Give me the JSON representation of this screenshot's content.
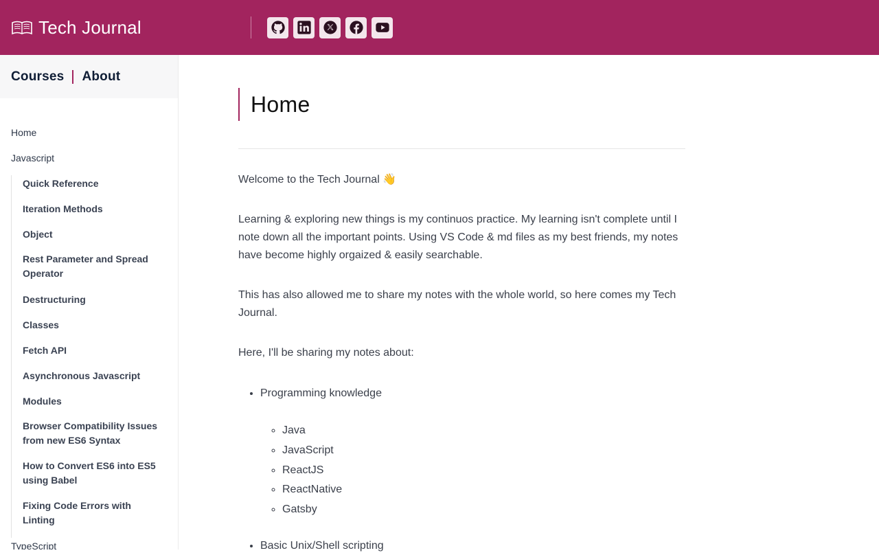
{
  "header": {
    "title": "Tech Journal",
    "brand_icon": "open-book-icon",
    "background": "#a2245e",
    "socials": [
      {
        "name": "github-icon"
      },
      {
        "name": "linkedin-icon"
      },
      {
        "name": "x-twitter-icon"
      },
      {
        "name": "facebook-icon"
      },
      {
        "name": "youtube-icon"
      }
    ]
  },
  "sidebar": {
    "top_links": [
      "Courses",
      "About"
    ],
    "items": {
      "home": "Home",
      "javascript": "Javascript",
      "sub": [
        "Quick Reference",
        "Iteration Methods",
        "Object",
        "Rest Parameter and Spread Operator",
        "Destructuring",
        "Classes",
        "Fetch API",
        "Asynchronous Javascript",
        "Modules",
        "Browser Compatibility Issues from new ES6 Syntax",
        "How to Convert ES6 into ES5 using Babel",
        "Fixing Code Errors with Linting"
      ],
      "typescript": "TypeScript"
    }
  },
  "main": {
    "title": "Home",
    "paragraphs": [
      "Welcome to the Tech Journal 👋",
      "Learning & exploring new things is my continuos practice. My learning isn't complete until I note down all the important points. Using VS Code & md files as my best friends, my notes have become highly orgaized & easily searchable.",
      "This has also allowed me to share my notes with the whole world, so here comes my Tech Journal.",
      "Here, I'll be sharing my notes about:"
    ],
    "list": {
      "programming": "Programming knowledge",
      "languages": [
        "Java",
        "JavaScript",
        "ReactJS",
        "ReactNative",
        "Gatsby"
      ],
      "unix": "Basic Unix/Shell scripting"
    }
  },
  "colors": {
    "accent": "#a2245e",
    "nav_text": "#0f1d35"
  }
}
